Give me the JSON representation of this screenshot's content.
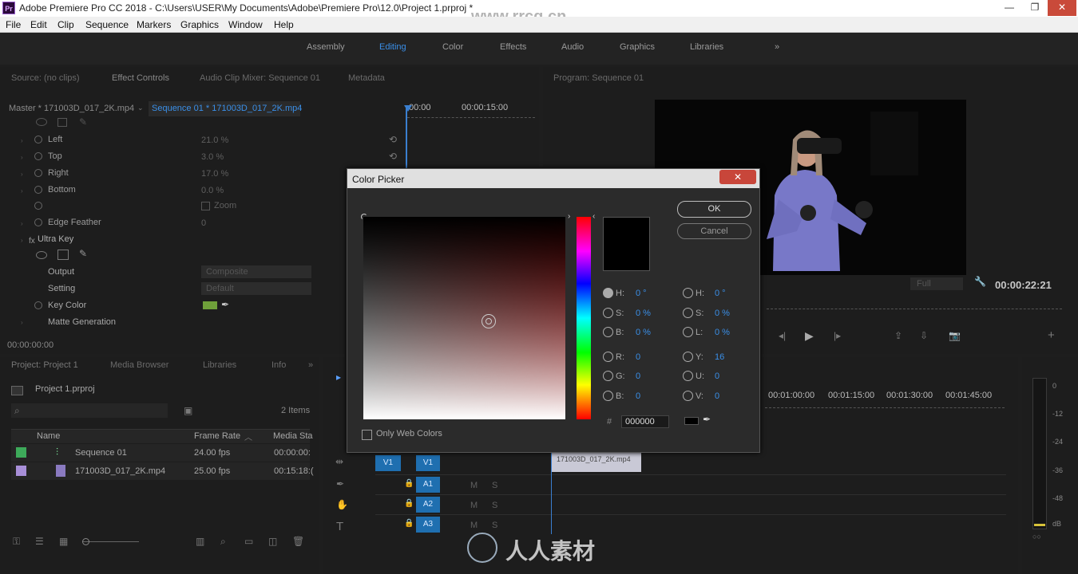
{
  "titlebar": {
    "app_icon": "Pr",
    "title": "Adobe Premiere Pro CC 2018 - C:\\Users\\USER\\My Documents\\Adobe\\Premiere Pro\\12.0\\Project 1.prproj *",
    "minimize": "—",
    "maximize": "❐",
    "close": "✕"
  },
  "menu": [
    "File",
    "Edit",
    "Clip",
    "Sequence",
    "Markers",
    "Graphics",
    "Window",
    "Help"
  ],
  "workspaces": [
    "Assembly",
    "Editing",
    "Color",
    "Effects",
    "Audio",
    "Graphics",
    "Libraries",
    "»"
  ],
  "watermark": "www.rrcg.cn",
  "effects_panel": {
    "tabs": [
      "Source: (no clips)",
      "Effect Controls",
      "Audio Clip Mixer: Sequence 01",
      "Metadata"
    ],
    "master_clip": "Master * 171003D_017_2K.mp4",
    "sequence_clip": "Sequence 01 * 171003D_017_2K.mp4",
    "ruler": [
      "00:00",
      "00:00:15:00"
    ],
    "crop": [
      {
        "label": "Left",
        "value": "21.0 %"
      },
      {
        "label": "Top",
        "value": "3.0 %"
      },
      {
        "label": "Right",
        "value": "17.0 %"
      },
      {
        "label": "Bottom",
        "value": "0.0 %"
      }
    ],
    "zoom_label": "Zoom",
    "edge_feather": {
      "label": "Edge Feather",
      "value": "0"
    },
    "ultra_key": "Ultra Key",
    "output": {
      "label": "Output",
      "value": "Composite"
    },
    "setting": {
      "label": "Setting",
      "value": "Default"
    },
    "key_color": {
      "label": "Key Color",
      "swatch": "#6fa03a"
    },
    "matte_generation": "Matte Generation",
    "timecode": "00:00:00:00"
  },
  "program": {
    "tab": "Program: Sequence 01",
    "fit": "Full",
    "timecode": "00:00:22:21"
  },
  "project": {
    "tabs": [
      "Project: Project 1",
      "Media Browser",
      "Libraries",
      "Info",
      "»"
    ],
    "name": "Project 1.prproj",
    "items_count": "2 Items",
    "columns": [
      "Name",
      "Frame Rate",
      "Media Sta"
    ],
    "rows": [
      {
        "color": "#3daa5a",
        "name": "Sequence 01",
        "rate": "24.00 fps",
        "start": "00:00:00:"
      },
      {
        "color": "#a88fd8",
        "name": "171003D_017_2K.mp4",
        "rate": "25.00 fps",
        "start": "00:15:18:("
      }
    ]
  },
  "timeline": {
    "ruler": [
      "00:01:00:00",
      "00:01:15:00",
      "00:01:30:00",
      "00:01:45:00"
    ],
    "tracks": [
      "V1",
      "V1",
      "A1",
      "A2",
      "A3"
    ],
    "clip": "171003D_017_2K.mp4",
    "track_m": "M",
    "track_s": "S"
  },
  "meters": {
    "scale": [
      "0",
      "-12",
      "-24",
      "-36",
      "-48",
      "dB"
    ]
  },
  "color_picker": {
    "title": "Color Picker",
    "close": "✕",
    "ok": "OK",
    "cancel": "Cancel",
    "hsb": [
      {
        "label": "H:",
        "value": "0 °"
      },
      {
        "label": "S:",
        "value": "0 %"
      },
      {
        "label": "B:",
        "value": "0 %"
      }
    ],
    "rgb": [
      {
        "label": "R:",
        "value": "0"
      },
      {
        "label": "G:",
        "value": "0"
      },
      {
        "label": "B:",
        "value": "0"
      }
    ],
    "hsl": [
      {
        "label": "H:",
        "value": "0 °"
      },
      {
        "label": "S:",
        "value": "0 %"
      },
      {
        "label": "L:",
        "value": "0 %"
      }
    ],
    "yuv": [
      {
        "label": "Y:",
        "value": "16"
      },
      {
        "label": "U:",
        "value": "0"
      },
      {
        "label": "V:",
        "value": "0"
      }
    ],
    "hex_label": "#",
    "hex": "000000",
    "web_colors": "Only Web Colors",
    "current_color": "#000000"
  },
  "footer_logo": "人人素材"
}
